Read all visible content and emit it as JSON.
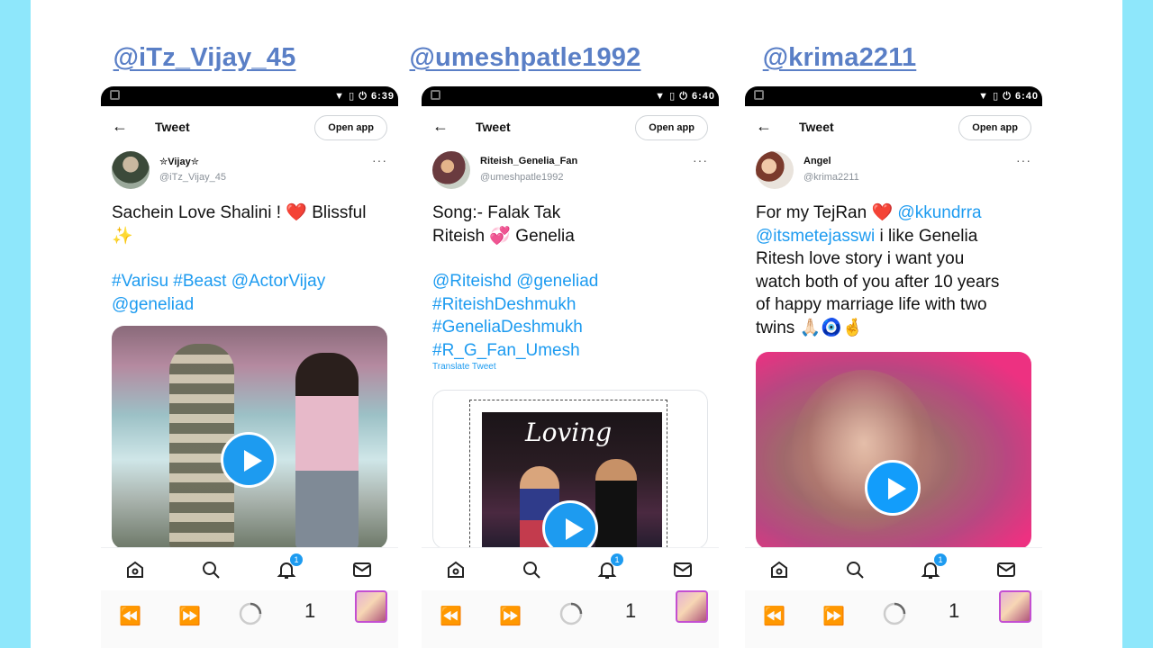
{
  "phones": [
    {
      "caption": "@iTz_Vijay_45",
      "status_time": "6:39",
      "header": {
        "back": "←",
        "title": "Tweet",
        "open_app": "Open app"
      },
      "author": {
        "name": "✮Vijay✮",
        "handle": "@iTz_Vijay_45",
        "more": "···"
      },
      "tweet": {
        "line1": "Sachein Love Shalini ! ❤️ Blissful",
        "line2": "✨",
        "tags1": "#Varisu #Beast @ActorVijay",
        "tags2": "@geneliad"
      },
      "nav": {
        "notification_count": "1"
      },
      "browser": {
        "tab_count": "1"
      }
    },
    {
      "caption": "@umeshpatle1992",
      "status_time": "6:40",
      "header": {
        "back": "←",
        "title": "Tweet",
        "open_app": "Open app"
      },
      "author": {
        "name": "Riteish_Genelia_Fan",
        "handle": "@umeshpatle1992",
        "more": "···"
      },
      "tweet": {
        "line1": "Song:- Falak Tak",
        "line2": "Riteish 💞 Genelia",
        "tags1": "@Riteishd @geneliad",
        "tags2": "#RiteishDeshmukh",
        "tags3": "#GeneliaDeshmukh",
        "tags4": "#R_G_Fan_Umesh",
        "translate": "Translate Tweet"
      },
      "media_overlay": "Loving",
      "nav": {
        "notification_count": "1"
      },
      "browser": {
        "tab_count": "1"
      }
    },
    {
      "caption": "@krima2211",
      "status_time": "6:40",
      "header": {
        "back": "←",
        "title": "Tweet",
        "open_app": "Open app"
      },
      "author": {
        "name": "Angel",
        "handle": "@krima2211",
        "more": "···"
      },
      "tweet": {
        "l1a": "For my TejRan ❤️ ",
        "l1b": "@kkundrra",
        "l2a": "@itsmetejasswi",
        "l2b": "  i like Genelia",
        "l3": "Ritesh love story i want you",
        "l4": "watch both of you after 10 years",
        "l5": "of happy marriage life with two",
        "l6": "twins 🙏🏻🧿🤞"
      },
      "nav": {
        "notification_count": "1"
      },
      "browser": {
        "tab_count": "1"
      }
    }
  ],
  "colors": {
    "outer_bg": "#8ee7fb",
    "link": "#1d9bf0",
    "caption": "#5a7fc6"
  },
  "icons": [
    "back-arrow-icon",
    "home-icon",
    "search-icon",
    "bell-icon",
    "mail-icon",
    "rewind-icon",
    "forward-icon",
    "loading-icon",
    "play-icon"
  ]
}
